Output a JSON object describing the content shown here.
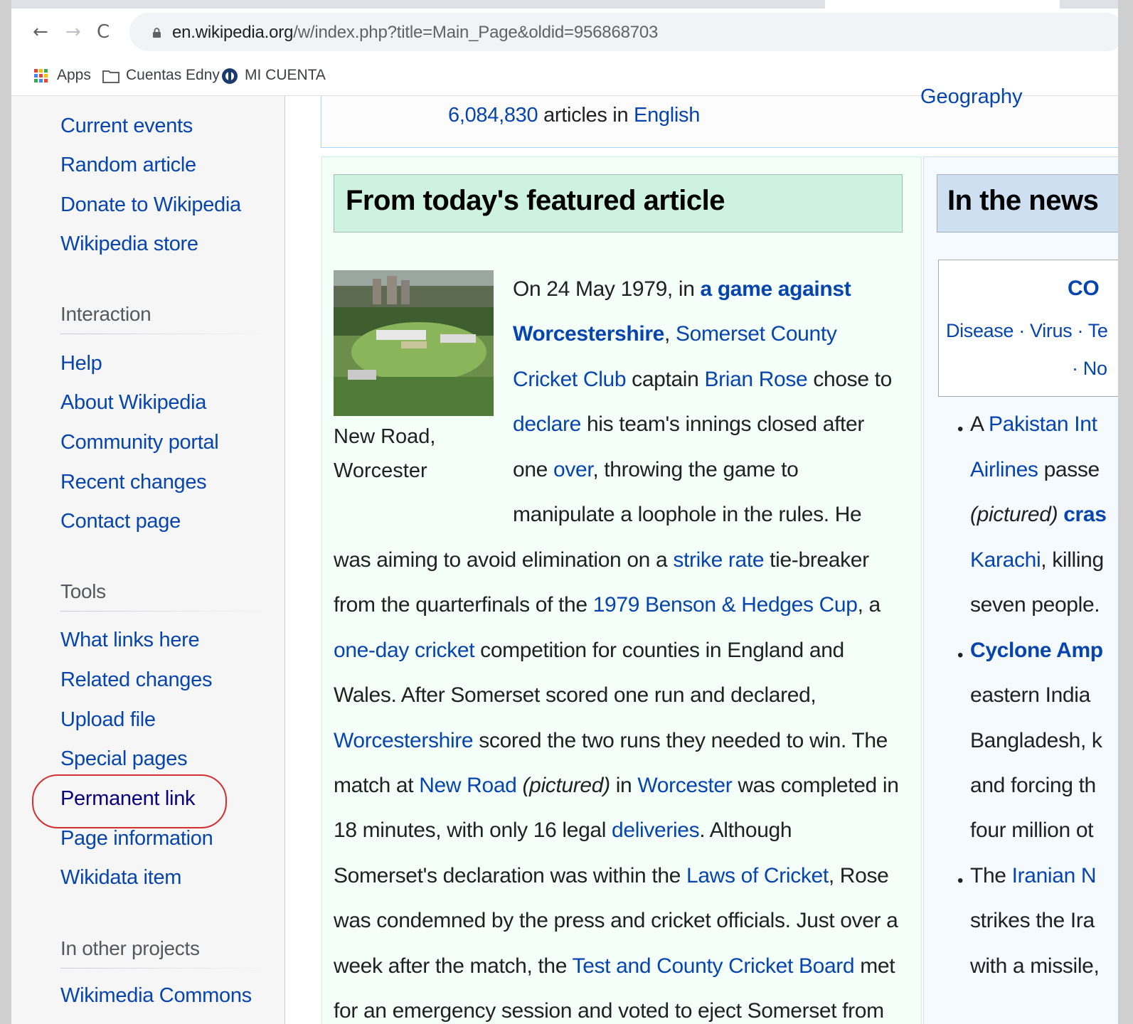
{
  "browser": {
    "url_host": "en.wikipedia.org",
    "url_path": "/w/index.php?title=Main_Page&oldid=956868703",
    "bookmarks": [
      {
        "label": "Apps",
        "icon": "apps-grid-icon"
      },
      {
        "label": "Cuentas Edny",
        "icon": "folder-icon"
      },
      {
        "label": "MI CUENTA",
        "icon": "globe-icon"
      }
    ]
  },
  "sidebar": {
    "nav_links": [
      "Current events",
      "Random article",
      "Donate to Wikipedia",
      "Wikipedia store"
    ],
    "interaction_heading": "Interaction",
    "interaction_links": [
      "Help",
      "About Wikipedia",
      "Community portal",
      "Recent changes",
      "Contact page"
    ],
    "tools_heading": "Tools",
    "tools_links": [
      "What links here",
      "Related changes",
      "Upload file",
      "Special pages",
      "Permanent link",
      "Page information",
      "Wikidata item"
    ],
    "other_heading": "In other projects",
    "other_links": [
      "Wikimedia Commons"
    ],
    "highlight_color": "#d32f2f"
  },
  "header": {
    "article_count": "6,084,830",
    "articles_in": "articles in",
    "language": "English",
    "portal_link": "Geography"
  },
  "featured": {
    "heading": "From today's featured article",
    "image_caption_1": "New Road,",
    "image_caption_2": "Worcester",
    "l1_a": "On 24 May 1979, in ",
    "l1_b": "a game against",
    "l2_a": "Worcestershire",
    "l2_b": ", ",
    "l2_c": "Somerset County",
    "l3_a": "Cricket Club",
    "l3_b": " captain ",
    "l3_c": "Brian Rose",
    "l3_d": " chose to",
    "l4_a": "declare",
    "l4_b": " his team's innings closed after",
    "l5_a": "one ",
    "l5_b": "over",
    "l5_c": ", throwing the game to",
    "l6": "manipulate a loophole in the rules. He",
    "l7_a": "was aiming to avoid elimination on a ",
    "l7_b": "strike rate",
    "l7_c": " tie-breaker",
    "l8_a": "from the quarterfinals of the ",
    "l8_b": "1979 Benson & Hedges Cup",
    "l8_c": ", a",
    "l9_a": "one-day cricket",
    "l9_b": " competition for counties in England and",
    "l10": "Wales. After Somerset scored one run and declared,",
    "l11_a": "Worcestershire",
    "l11_b": " scored the two runs they needed to win. The",
    "l12_a": "match at ",
    "l12_b": "New Road",
    "l12_c": " ",
    "l12_d": "(pictured)",
    "l12_e": " in ",
    "l12_f": "Worcester",
    "l12_g": " was completed in",
    "l13_a": "18 minutes, with only 16 legal ",
    "l13_b": "deliveries",
    "l13_c": ". Although",
    "l14_a": "Somerset's declaration was within the ",
    "l14_b": "Laws of Cricket",
    "l14_c": ", Rose",
    "l15": "was condemned by the press and cricket officials. Just over a",
    "l16_a": "week after the match, the ",
    "l16_b": "Test and County Cricket Board",
    "l16_c": " met",
    "l17": "for an emergency session and voted to eject Somerset from"
  },
  "news": {
    "heading": "In the news",
    "covid_title": "CO",
    "covid_links_1": "Disease · Virus · Te",
    "covid_links_2": "· No",
    "b1_l1_a": "A ",
    "b1_l1_b": "Pakistan Int",
    "b1_l2_a": "Airlines",
    "b1_l2_b": " passe",
    "b1_l3_a": "(pictured)",
    "b1_l3_b": " cras",
    "b1_l4_a": "Karachi",
    "b1_l4_b": ", killing",
    "b1_l5": "seven people.",
    "b2_l1": "Cyclone Amp",
    "b2_l2": "eastern India",
    "b2_l3": "Bangladesh, k",
    "b2_l4": "and forcing th",
    "b2_l5": "four million ot",
    "b3_l1_a": "The ",
    "b3_l1_b": "Iranian N",
    "b3_l2": "strikes the Ira",
    "b3_l3": "with a missile,"
  }
}
